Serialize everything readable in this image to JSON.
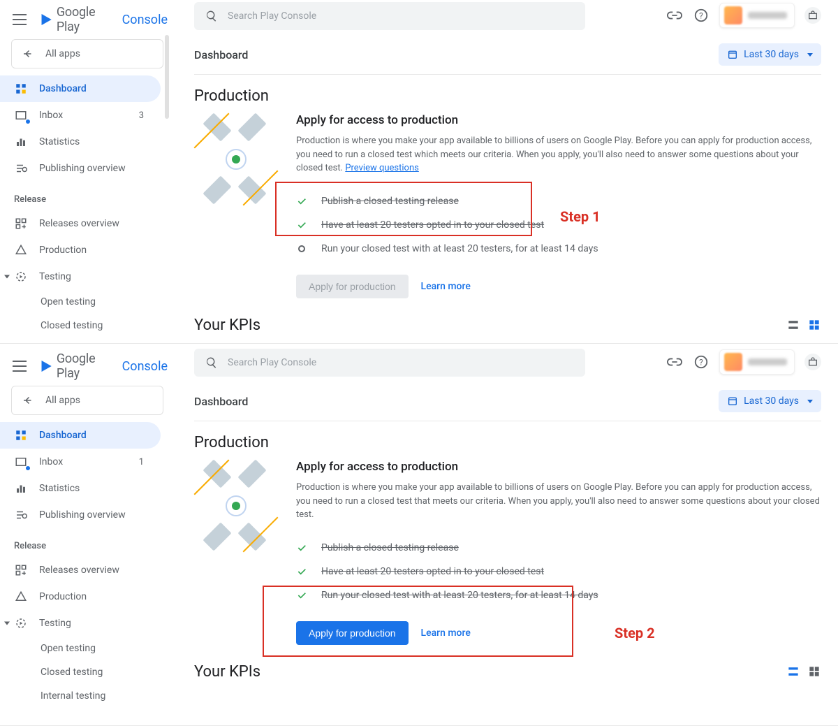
{
  "logo": {
    "google_play": "Google Play",
    "console": "Console"
  },
  "search": {
    "placeholder": "Search Play Console"
  },
  "all_apps": "All apps",
  "nav": {
    "dashboard": "Dashboard",
    "inbox": "Inbox",
    "statistics": "Statistics",
    "publishing_overview": "Publishing overview",
    "release_label": "Release",
    "releases_overview": "Releases overview",
    "production": "Production",
    "testing": "Testing",
    "open_testing": "Open testing",
    "closed_testing": "Closed testing",
    "internal_testing": "Internal testing"
  },
  "panel1": {
    "inbox_count": "3",
    "breadcrumb": "Dashboard",
    "date_range": "Last 30 days",
    "section_title": "Production",
    "card_title": "Apply for access to production",
    "card_body": "Production is where you make your app available to billions of users on Google Play. Before you can apply for production access, you need to run a closed test which meets our criteria. When you apply, you'll also need to answer some questions about your closed test.",
    "preview_link": "Preview questions",
    "tasks": [
      "Publish a closed testing release",
      "Have at least 20 testers opted in to your closed test",
      "Run your closed test with at least 20 testers, for at least 14 days"
    ],
    "apply_btn": "Apply for production",
    "learn_more": "Learn more",
    "kpi_title": "Your KPIs",
    "annot": "Step 1"
  },
  "panel2": {
    "inbox_count": "1",
    "breadcrumb": "Dashboard",
    "date_range": "Last 30 days",
    "section_title": "Production",
    "card_title": "Apply for access to production",
    "card_body": "Production is where you make your app available to billions of users on Google Play. Before you can apply for production access, you need to run a closed test that meets our criteria. When you apply, you'll also need to answer some questions about your closed test.",
    "tasks": [
      "Publish a closed testing release",
      "Have at least 20 testers opted in to your closed test",
      "Run your closed test with at least 20 testers, for at least 14 days"
    ],
    "apply_btn": "Apply for production",
    "learn_more": "Learn more",
    "kpi_title": "Your KPIs",
    "annot": "Step 2"
  }
}
